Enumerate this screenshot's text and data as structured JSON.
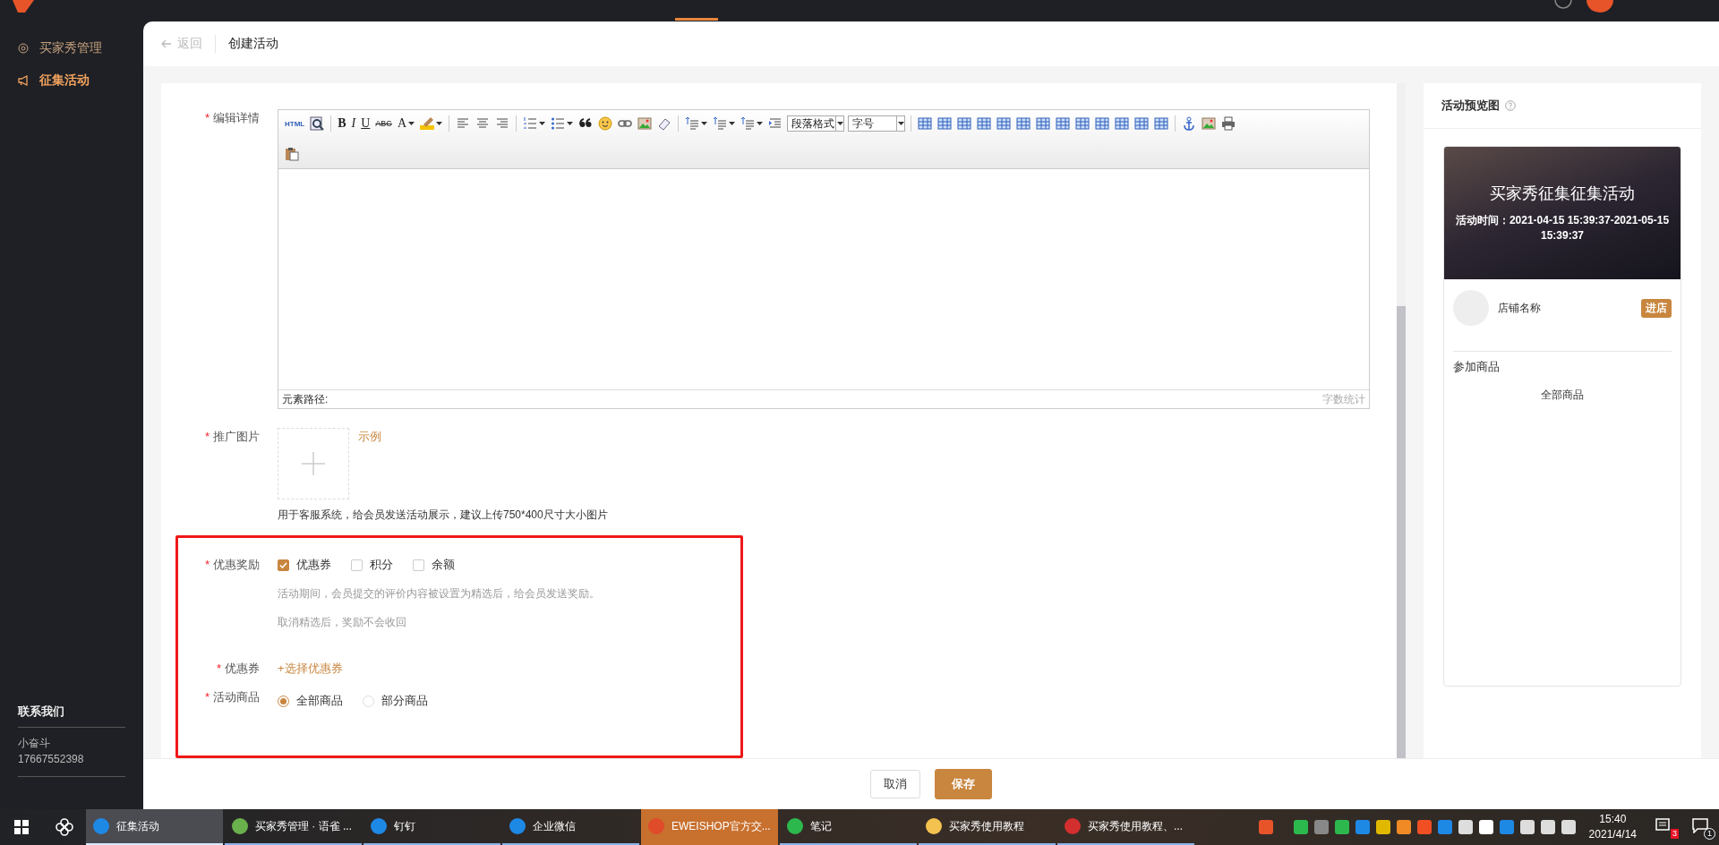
{
  "sidebar": {
    "items": [
      {
        "label": "买家秀管理",
        "selected": false
      },
      {
        "label": "征集活动",
        "selected": true
      }
    ],
    "contact": {
      "title": "联系我们",
      "name": "小奋斗",
      "phone": "17667552398"
    }
  },
  "breadcrumb": {
    "back": "返回",
    "title": "创建活动"
  },
  "form": {
    "editor": {
      "mark": "*",
      "label": "编辑详情",
      "glyphs": [
        "HTML",
        "B",
        "I",
        "U",
        "ABC",
        "A"
      ],
      "selects": [
        "段落格式",
        "字号"
      ],
      "path_label": "元素路径:",
      "word_count": "字数统计"
    },
    "image": {
      "mark": "*",
      "label": "推广图片",
      "example": "示例",
      "hint": "用于客服系统，给会员发送活动展示，建议上传750*400尺寸大小图片"
    },
    "reward": {
      "mark": "*",
      "label": "优惠奖励",
      "options": [
        {
          "label": "优惠券",
          "checked": true
        },
        {
          "label": "积分",
          "checked": false
        },
        {
          "label": "余额",
          "checked": false
        }
      ],
      "notes": [
        "活动期间，会员提交的评价内容被设置为精选后，给会员发送奖励。",
        "取消精选后，奖励不会收回"
      ]
    },
    "coupon": {
      "mark": "*",
      "label": "优惠券",
      "action": "+选择优惠券"
    },
    "goods": {
      "mark": "*",
      "label": "活动商品",
      "options": [
        {
          "label": "全部商品",
          "selected": true
        },
        {
          "label": "部分商品",
          "selected": false
        }
      ]
    }
  },
  "preview": {
    "title": "活动预览图",
    "banner_title": "买家秀征集征集活动",
    "banner_time": "活动时间：2021-04-15 15:39:37-2021-05-15 15:39:37",
    "shop_name": "店铺名称",
    "shop_button": "进店",
    "goods_title": "参加商品",
    "goods_value": "全部商品"
  },
  "footer": {
    "buttons": [
      {
        "label": "取消",
        "kind": "default"
      },
      {
        "label": "保存",
        "kind": "primary"
      }
    ]
  },
  "taskbar": {
    "items": [
      {
        "label": "征集活动",
        "selected": true,
        "attention": false
      },
      {
        "label": "买家秀管理 · 语雀 ...",
        "selected": false,
        "attention": false
      },
      {
        "label": "钉钉",
        "selected": false,
        "attention": false
      },
      {
        "label": "企业微信",
        "selected": false,
        "attention": false
      },
      {
        "label": "EWEISHOP官方交...",
        "selected": false,
        "attention": true
      },
      {
        "label": "笔记",
        "selected": false,
        "attention": false
      },
      {
        "label": "买家秀使用教程",
        "selected": false,
        "attention": false
      },
      {
        "label": "买家秀使用教程、...",
        "selected": false,
        "attention": false
      }
    ],
    "clock": {
      "time": "15:40",
      "date": "2021/4/14"
    },
    "notification_count": "3",
    "action_center_count": "1"
  }
}
